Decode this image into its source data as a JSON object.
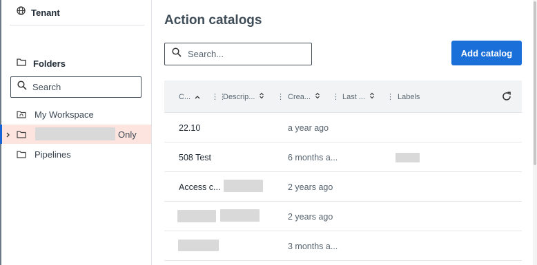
{
  "sidebar": {
    "tenant_label": "Tenant",
    "folders_label": "Folders",
    "search_placeholder": "Search",
    "items": [
      {
        "label": "My Workspace"
      },
      {
        "label": "Only"
      },
      {
        "label": "Pipelines"
      }
    ]
  },
  "main": {
    "title": "Action catalogs",
    "search_placeholder": "Search...",
    "add_button": "Add catalog",
    "table": {
      "columns": [
        "C...",
        "Descrip...",
        "Crea...",
        "Last ...",
        "Labels"
      ],
      "rows": [
        {
          "name": "22.10",
          "created": "a year ago"
        },
        {
          "name": "508 Test",
          "created": "6 months a..."
        },
        {
          "name": "Access c...",
          "created": "2 years ago"
        },
        {
          "name": "",
          "created": "2 years ago"
        },
        {
          "name": "",
          "created": "3 months a..."
        }
      ]
    }
  },
  "colors": {
    "accent": "#1a6fd9",
    "active_row_bg": "#fde4df",
    "active_bar": "#1565d8"
  }
}
